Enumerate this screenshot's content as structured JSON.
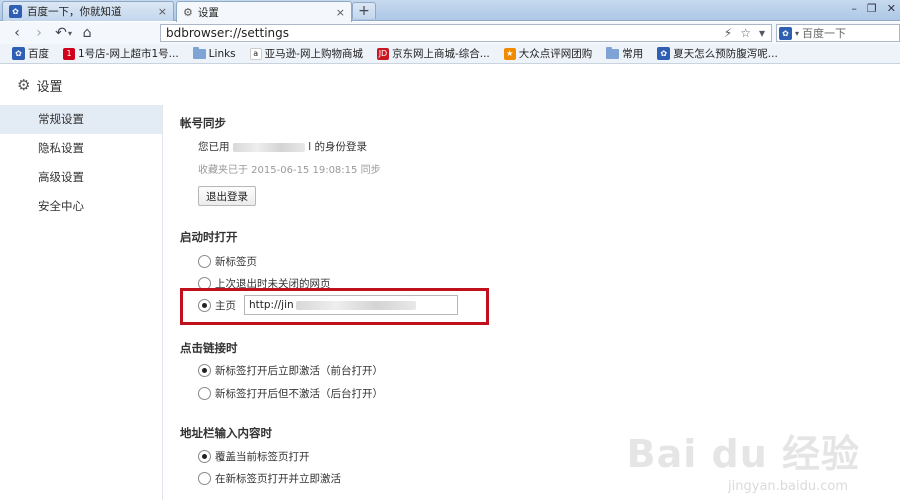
{
  "tabs": [
    {
      "title": "百度一下，你就知道",
      "close": "×"
    },
    {
      "title": "设置",
      "close": "×"
    }
  ],
  "new_tab": "+",
  "window_controls": {
    "minimize": "–",
    "restore": "❐",
    "close": "✕"
  },
  "nav": {
    "back": "‹",
    "forward": "›",
    "undo": "↶",
    "dropdown": "▾",
    "home": "⌂"
  },
  "address": {
    "url": "bdbrowser://settings",
    "flash_icon": "⚡",
    "star_icon": "☆",
    "menu_icon": "▾"
  },
  "search": {
    "placeholder": "百度一下",
    "engine_icon": "paw-icon",
    "dropdown": "▾"
  },
  "bookmarks": [
    {
      "label": "百度",
      "icon": "paw-icon",
      "color": "#2f5fb3"
    },
    {
      "label": "1号店-网上超市1号...",
      "icon": "yhd-icon",
      "color": "#d0021b"
    },
    {
      "label": "Links",
      "icon": "folder-icon",
      "color": "#7ea4d6"
    },
    {
      "label": "亚马逊-网上购物商城",
      "icon": "amazon-icon",
      "color": "#f0a020"
    },
    {
      "label": "京东网上商城-综合...",
      "icon": "jd-icon",
      "color": "#c81623"
    },
    {
      "label": "大众点评网团购",
      "icon": "dianping-icon",
      "color": "#f08a00"
    },
    {
      "label": "常用",
      "icon": "folder-icon",
      "color": "#7ea4d6"
    },
    {
      "label": "夏天怎么预防腹泻呢...",
      "icon": "paw-icon",
      "color": "#2f5fb3"
    }
  ],
  "page_title": "设置",
  "sidebar": {
    "items": [
      {
        "label": "常规设置",
        "active": true
      },
      {
        "label": "隐私设置",
        "active": false
      },
      {
        "label": "高级设置",
        "active": false
      },
      {
        "label": "安全中心",
        "active": false
      }
    ]
  },
  "account": {
    "title": "帐号同步",
    "login_prefix": "您已用",
    "login_suffix": "l 的身份登录",
    "favorites_sync": "收藏夹已于 2015-06-15 19:08:15 同步",
    "logout_button": "退出登录"
  },
  "startup": {
    "title": "启动时打开",
    "options": [
      "新标签页",
      "上次退出时未关闭的网页",
      "主页"
    ],
    "selected": 2,
    "homepage_value": "http://jin"
  },
  "link_click": {
    "title": "点击链接时",
    "options": [
      "新标签打开后立即激活（前台打开）",
      "新标签打开后但不激活（后台打开）"
    ],
    "selected": 0
  },
  "address_input": {
    "title": "地址栏输入内容时",
    "options": [
      "覆盖当前标签页打开",
      "在新标签页打开并立即激活"
    ],
    "selected": 0
  },
  "watermark": {
    "main": "Bai du 经验",
    "sub": "jingyan.baidu.com"
  }
}
